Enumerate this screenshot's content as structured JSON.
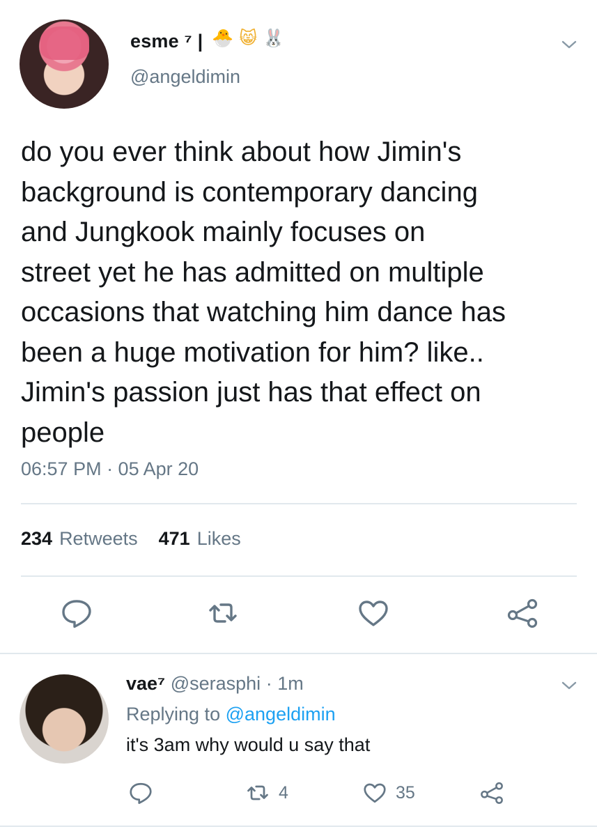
{
  "tweet": {
    "display_name": "esme ⁷ |",
    "badges": [
      "🐣",
      "😸",
      "🐰"
    ],
    "handle": "@angeldimin",
    "text": "do you ever think about how Jimin's\nbackground is contemporary dancing\nand Jungkook mainly focuses on\nstreet yet he has admitted on multiple\noccasions that watching him dance has\nbeen a huge motivation for him? like..\nJimin's passion just has that effect on\npeople",
    "timestamp": "06:57 PM · 05 Apr 20",
    "retweets_count": "234",
    "retweets_label": "Retweets",
    "likes_count": "471",
    "likes_label": "Likes"
  },
  "reply": {
    "display_name": "vae⁷",
    "handle": "@serasphi",
    "separator": "·",
    "time": "1m",
    "replying_prefix": "Replying to",
    "replying_handle": "@angeldimin",
    "text": "it's 3am why would u say that",
    "retweet_count": "4",
    "like_count": "35"
  },
  "colors": {
    "text": "#14171a",
    "secondary": "#657786",
    "link": "#1da1f2",
    "divider": "#e1e8ed"
  },
  "icons": [
    "chevron-down-icon",
    "reply-icon",
    "retweet-icon",
    "heart-icon",
    "share-icon"
  ]
}
